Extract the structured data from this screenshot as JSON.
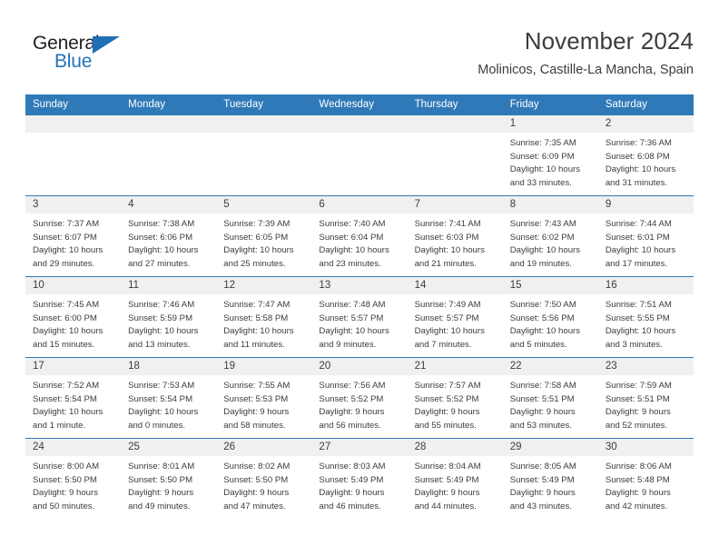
{
  "logo": {
    "word_top": "General",
    "word_bottom": "Blue",
    "triangle_color": "#1f6fb5",
    "blue_color": "#2272b9"
  },
  "header": {
    "title": "November 2024",
    "subtitle": "Molinicos, Castille-La Mancha, Spain"
  },
  "theme": {
    "header_bg": "#3079b8",
    "daynum_bg": "#f0f0f0",
    "text": "#3c3c3c"
  },
  "weekdays": [
    "Sunday",
    "Monday",
    "Tuesday",
    "Wednesday",
    "Thursday",
    "Friday",
    "Saturday"
  ],
  "weeks": [
    [
      {
        "day": "",
        "lines": []
      },
      {
        "day": "",
        "lines": []
      },
      {
        "day": "",
        "lines": []
      },
      {
        "day": "",
        "lines": []
      },
      {
        "day": "",
        "lines": []
      },
      {
        "day": "1",
        "lines": [
          "Sunrise: 7:35 AM",
          "Sunset: 6:09 PM",
          "Daylight: 10 hours",
          "and 33 minutes."
        ]
      },
      {
        "day": "2",
        "lines": [
          "Sunrise: 7:36 AM",
          "Sunset: 6:08 PM",
          "Daylight: 10 hours",
          "and 31 minutes."
        ]
      }
    ],
    [
      {
        "day": "3",
        "lines": [
          "Sunrise: 7:37 AM",
          "Sunset: 6:07 PM",
          "Daylight: 10 hours",
          "and 29 minutes."
        ]
      },
      {
        "day": "4",
        "lines": [
          "Sunrise: 7:38 AM",
          "Sunset: 6:06 PM",
          "Daylight: 10 hours",
          "and 27 minutes."
        ]
      },
      {
        "day": "5",
        "lines": [
          "Sunrise: 7:39 AM",
          "Sunset: 6:05 PM",
          "Daylight: 10 hours",
          "and 25 minutes."
        ]
      },
      {
        "day": "6",
        "lines": [
          "Sunrise: 7:40 AM",
          "Sunset: 6:04 PM",
          "Daylight: 10 hours",
          "and 23 minutes."
        ]
      },
      {
        "day": "7",
        "lines": [
          "Sunrise: 7:41 AM",
          "Sunset: 6:03 PM",
          "Daylight: 10 hours",
          "and 21 minutes."
        ]
      },
      {
        "day": "8",
        "lines": [
          "Sunrise: 7:43 AM",
          "Sunset: 6:02 PM",
          "Daylight: 10 hours",
          "and 19 minutes."
        ]
      },
      {
        "day": "9",
        "lines": [
          "Sunrise: 7:44 AM",
          "Sunset: 6:01 PM",
          "Daylight: 10 hours",
          "and 17 minutes."
        ]
      }
    ],
    [
      {
        "day": "10",
        "lines": [
          "Sunrise: 7:45 AM",
          "Sunset: 6:00 PM",
          "Daylight: 10 hours",
          "and 15 minutes."
        ]
      },
      {
        "day": "11",
        "lines": [
          "Sunrise: 7:46 AM",
          "Sunset: 5:59 PM",
          "Daylight: 10 hours",
          "and 13 minutes."
        ]
      },
      {
        "day": "12",
        "lines": [
          "Sunrise: 7:47 AM",
          "Sunset: 5:58 PM",
          "Daylight: 10 hours",
          "and 11 minutes."
        ]
      },
      {
        "day": "13",
        "lines": [
          "Sunrise: 7:48 AM",
          "Sunset: 5:57 PM",
          "Daylight: 10 hours",
          "and 9 minutes."
        ]
      },
      {
        "day": "14",
        "lines": [
          "Sunrise: 7:49 AM",
          "Sunset: 5:57 PM",
          "Daylight: 10 hours",
          "and 7 minutes."
        ]
      },
      {
        "day": "15",
        "lines": [
          "Sunrise: 7:50 AM",
          "Sunset: 5:56 PM",
          "Daylight: 10 hours",
          "and 5 minutes."
        ]
      },
      {
        "day": "16",
        "lines": [
          "Sunrise: 7:51 AM",
          "Sunset: 5:55 PM",
          "Daylight: 10 hours",
          "and 3 minutes."
        ]
      }
    ],
    [
      {
        "day": "17",
        "lines": [
          "Sunrise: 7:52 AM",
          "Sunset: 5:54 PM",
          "Daylight: 10 hours",
          "and 1 minute."
        ]
      },
      {
        "day": "18",
        "lines": [
          "Sunrise: 7:53 AM",
          "Sunset: 5:54 PM",
          "Daylight: 10 hours",
          "and 0 minutes."
        ]
      },
      {
        "day": "19",
        "lines": [
          "Sunrise: 7:55 AM",
          "Sunset: 5:53 PM",
          "Daylight: 9 hours",
          "and 58 minutes."
        ]
      },
      {
        "day": "20",
        "lines": [
          "Sunrise: 7:56 AM",
          "Sunset: 5:52 PM",
          "Daylight: 9 hours",
          "and 56 minutes."
        ]
      },
      {
        "day": "21",
        "lines": [
          "Sunrise: 7:57 AM",
          "Sunset: 5:52 PM",
          "Daylight: 9 hours",
          "and 55 minutes."
        ]
      },
      {
        "day": "22",
        "lines": [
          "Sunrise: 7:58 AM",
          "Sunset: 5:51 PM",
          "Daylight: 9 hours",
          "and 53 minutes."
        ]
      },
      {
        "day": "23",
        "lines": [
          "Sunrise: 7:59 AM",
          "Sunset: 5:51 PM",
          "Daylight: 9 hours",
          "and 52 minutes."
        ]
      }
    ],
    [
      {
        "day": "24",
        "lines": [
          "Sunrise: 8:00 AM",
          "Sunset: 5:50 PM",
          "Daylight: 9 hours",
          "and 50 minutes."
        ]
      },
      {
        "day": "25",
        "lines": [
          "Sunrise: 8:01 AM",
          "Sunset: 5:50 PM",
          "Daylight: 9 hours",
          "and 49 minutes."
        ]
      },
      {
        "day": "26",
        "lines": [
          "Sunrise: 8:02 AM",
          "Sunset: 5:50 PM",
          "Daylight: 9 hours",
          "and 47 minutes."
        ]
      },
      {
        "day": "27",
        "lines": [
          "Sunrise: 8:03 AM",
          "Sunset: 5:49 PM",
          "Daylight: 9 hours",
          "and 46 minutes."
        ]
      },
      {
        "day": "28",
        "lines": [
          "Sunrise: 8:04 AM",
          "Sunset: 5:49 PM",
          "Daylight: 9 hours",
          "and 44 minutes."
        ]
      },
      {
        "day": "29",
        "lines": [
          "Sunrise: 8:05 AM",
          "Sunset: 5:49 PM",
          "Daylight: 9 hours",
          "and 43 minutes."
        ]
      },
      {
        "day": "30",
        "lines": [
          "Sunrise: 8:06 AM",
          "Sunset: 5:48 PM",
          "Daylight: 9 hours",
          "and 42 minutes."
        ]
      }
    ]
  ]
}
